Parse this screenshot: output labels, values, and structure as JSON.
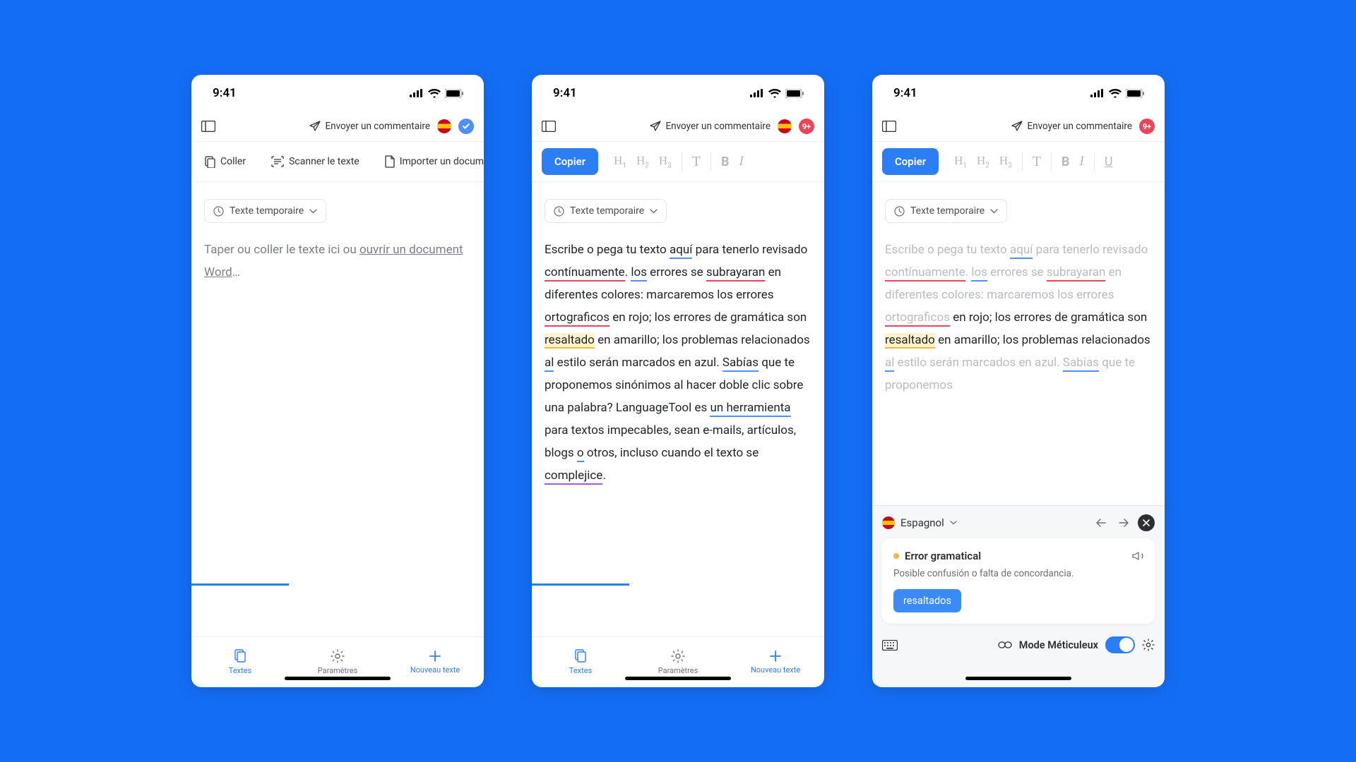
{
  "status": {
    "time": "9:41"
  },
  "header": {
    "feedback": "Envoyer un commentaire",
    "badge_9plus": "9+",
    "badge_check": "✓"
  },
  "toolbar1": {
    "paste": "Coller",
    "scan": "Scanner le texte",
    "import": "Importer un document",
    "chip": "Texte temporaire"
  },
  "toolbar2": {
    "copy": "Copier",
    "chip": "Texte temporaire"
  },
  "placeholder": {
    "pre": "Taper ou coller le texte ici ou ",
    "link": "ouvrir un document Word",
    "post": "…"
  },
  "sample": {
    "p1a": "Escribe o pega tu texto ",
    "aqui": "aquí",
    "p1b": " para tenerlo revisado ",
    "cont": "contínuamente",
    "p1c": ". ",
    "los": "los",
    "p1d": " errores se ",
    "sub": "subrayaran",
    "p1e": " en diferentes colores: marcaremos los errores ",
    "orto": "ortograficos",
    "p1f": " en rojo; los errores de gramática son ",
    "res": "resaltado",
    "p1g": " en amarillo; los problemas relacionados ",
    "al": "al",
    "p1h": " estilo serán marcados en azul. ",
    "sab": "Sabías",
    "p1i": " que te proponemos sinónimos al hacer doble clic sobre una palabra? LanguageTool es ",
    "herr": "un herramienta",
    "p1j": " para textos impecables, sean e-mails, artículos, blogs ",
    "o": "o",
    "p1k": " otros, incluso cuando el texto se ",
    "comp": "complejice",
    "p1l": "."
  },
  "nav": {
    "texts": "Textes",
    "settings": "Paramètres",
    "new": "Nouveau texte"
  },
  "panel": {
    "lang": "Espagnol",
    "title": "Error gramatical",
    "desc": "Posible confusión o falta de concordancia.",
    "suggestion": "resaltados",
    "mode": "Mode Méticuleux"
  }
}
